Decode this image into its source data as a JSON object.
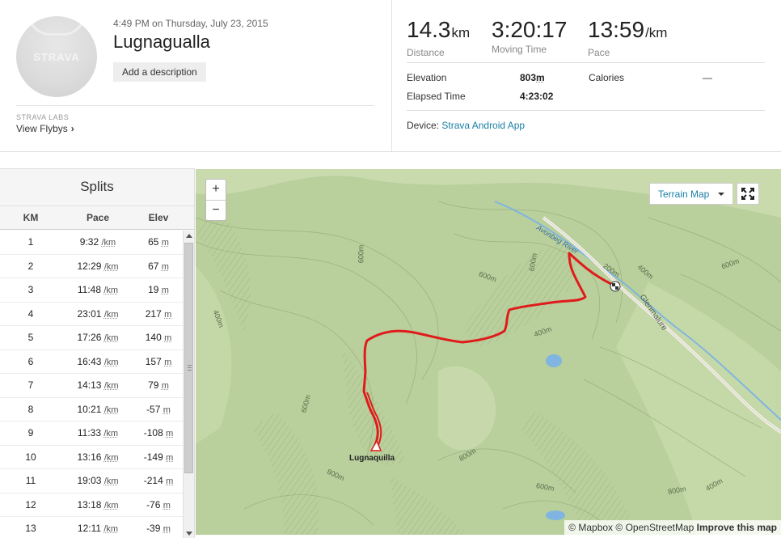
{
  "header": {
    "datetime": "4:49 PM on Thursday, July 23, 2015",
    "title": "Lugnagualla",
    "avatar_brand": "STRAVA",
    "add_description_label": "Add a description",
    "labs_label": "STRAVA LABS",
    "flybys_label": "View Flybys"
  },
  "stats": {
    "distance": {
      "value": "14.3",
      "unit": "km",
      "label": "Distance"
    },
    "moving_time": {
      "value": "3:20:17",
      "label": "Moving Time"
    },
    "pace": {
      "value": "13:59",
      "unit": "/km",
      "label": "Pace"
    },
    "elevation": {
      "label": "Elevation",
      "value": "803",
      "unit": "m"
    },
    "calories": {
      "label": "Calories",
      "value": "—"
    },
    "elapsed": {
      "label": "Elapsed Time",
      "value": "4:23:02"
    },
    "device_label": "Device:",
    "device_value": "Strava Android App"
  },
  "splits": {
    "title": "Splits",
    "columns": [
      "KM",
      "Pace",
      "Elev"
    ],
    "pace_unit": "/km",
    "elev_unit": "m",
    "rows": [
      {
        "km": "1",
        "pace": "9:32",
        "elev": "65"
      },
      {
        "km": "2",
        "pace": "12:29",
        "elev": "67"
      },
      {
        "km": "3",
        "pace": "11:48",
        "elev": "19"
      },
      {
        "km": "4",
        "pace": "23:01",
        "elev": "217"
      },
      {
        "km": "5",
        "pace": "17:26",
        "elev": "140"
      },
      {
        "km": "6",
        "pace": "16:43",
        "elev": "157"
      },
      {
        "km": "7",
        "pace": "14:13",
        "elev": "79"
      },
      {
        "km": "8",
        "pace": "10:21",
        "elev": "-57"
      },
      {
        "km": "9",
        "pace": "11:33",
        "elev": "-108"
      },
      {
        "km": "10",
        "pace": "13:16",
        "elev": "-149"
      },
      {
        "km": "11",
        "pace": "19:03",
        "elev": "-214"
      },
      {
        "km": "12",
        "pace": "13:18",
        "elev": "-76"
      },
      {
        "km": "13",
        "pace": "12:11",
        "elev": "-39"
      }
    ]
  },
  "map": {
    "zoom_in": "+",
    "zoom_out": "−",
    "layer_label": "Terrain Map",
    "peak_label": "Lugnaquilla",
    "river_label": "Avonbeg River",
    "road_label": "Glenmalure",
    "contour_labels": [
      "600m",
      "400m",
      "600m",
      "600m",
      "200m",
      "400m",
      "600m",
      "400m",
      "600m",
      "800m",
      "800m",
      "600m",
      "800m",
      "400m"
    ],
    "attribution": {
      "mapbox": "© Mapbox",
      "osm": "© OpenStreetMap",
      "improve": "Improve this map"
    },
    "colors": {
      "route": "#e01b1b",
      "land": "#b7cc9b",
      "water": "#7fb5e0"
    }
  }
}
